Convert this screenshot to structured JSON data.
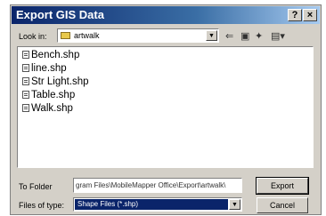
{
  "window": {
    "title": "Export GIS Data"
  },
  "titlebar_buttons": {
    "help": "?",
    "close": "×"
  },
  "lookin": {
    "label": "Look in:",
    "folder": "artwalk"
  },
  "files": [
    {
      "name": "Bench.shp"
    },
    {
      "name": "line.shp"
    },
    {
      "name": "Str Light.shp"
    },
    {
      "name": "Table.shp"
    },
    {
      "name": "Walk.shp"
    }
  ],
  "to_folder": {
    "label": "To Folder",
    "value": "gram Files\\MobileMapper Office\\Export\\artwalk\\"
  },
  "file_type": {
    "label": "Files of type:",
    "value": "Shape Files (*.shp)"
  },
  "buttons": {
    "export": "Export",
    "cancel": "Cancel"
  },
  "colors": {
    "title_start": "#0a246a",
    "title_end": "#a6caf0",
    "selection": "#0a246a",
    "face": "#d4d0c8"
  }
}
